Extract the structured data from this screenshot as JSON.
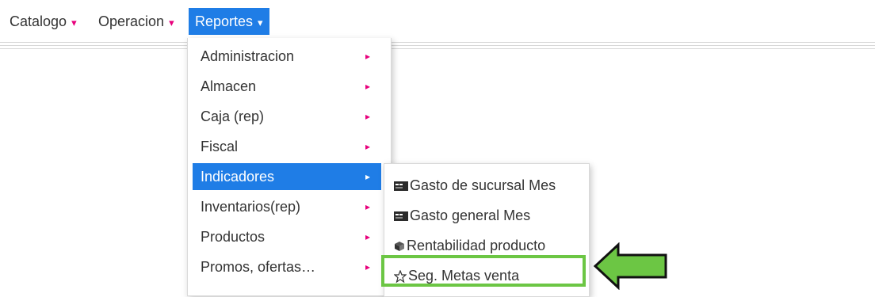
{
  "navbar": {
    "items": [
      {
        "label": "Catalogo",
        "caret": "▾"
      },
      {
        "label": "Operacion",
        "caret": "▾"
      },
      {
        "label": "Reportes",
        "caret": "▾"
      }
    ]
  },
  "reportes_menu": {
    "items": [
      {
        "label": "Administracion",
        "arrow": "▸"
      },
      {
        "label": "Almacen",
        "arrow": "▸"
      },
      {
        "label": "Caja (rep)",
        "arrow": "▸"
      },
      {
        "label": "Fiscal",
        "arrow": "▸"
      },
      {
        "label": "Indicadores",
        "arrow": "▸"
      },
      {
        "label": "Inventarios(rep)",
        "arrow": "▸"
      },
      {
        "label": "Productos",
        "arrow": "▸"
      },
      {
        "label": "Promos, ofertas…",
        "arrow": "▸"
      }
    ]
  },
  "indicadores_submenu": {
    "items": [
      {
        "label": "Gasto de sucursal Mes",
        "icon": "report-icon"
      },
      {
        "label": "Gasto general Mes",
        "icon": "report-icon"
      },
      {
        "label": "Rentabilidad producto",
        "icon": "box-icon"
      },
      {
        "label": "Seg. Metas venta",
        "icon": "star-outline-icon"
      }
    ]
  },
  "colors": {
    "active": "#1f7de6",
    "caret": "#e8007c",
    "highlight": "#6cc644"
  }
}
